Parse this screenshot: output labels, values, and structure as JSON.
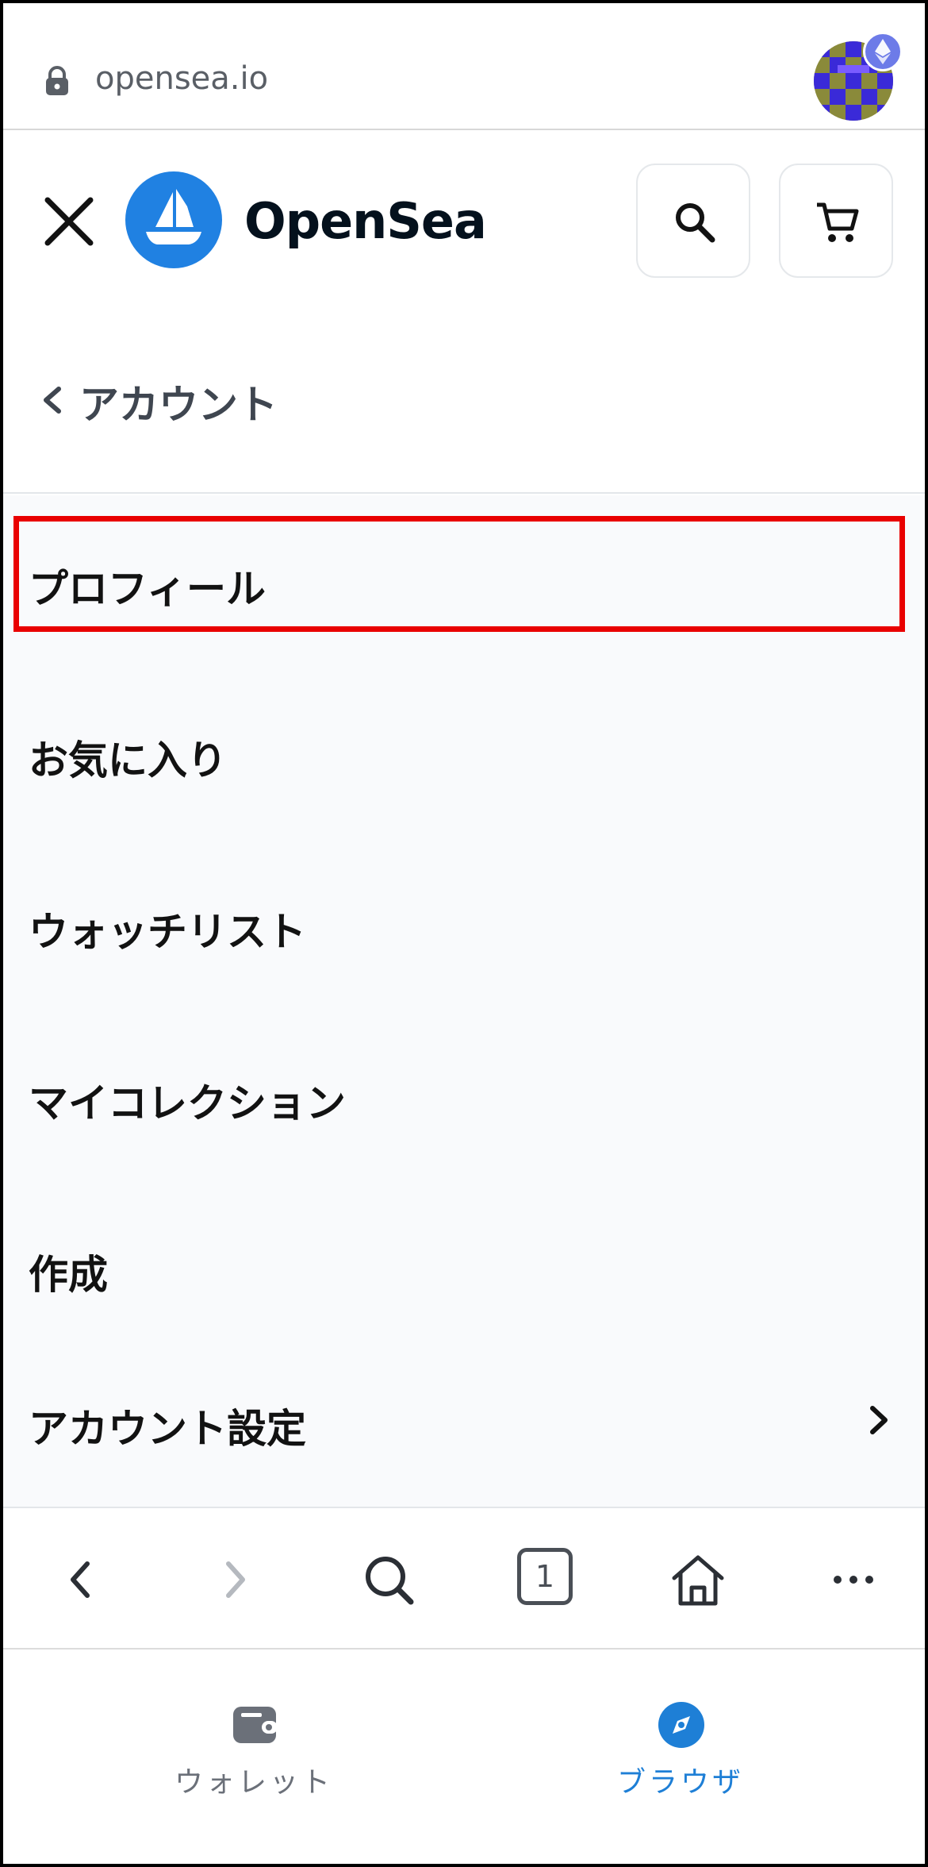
{
  "browser": {
    "url": "opensea.io"
  },
  "header": {
    "brand": "OpenSea",
    "logo_icon": "opensea-ship-logo",
    "buttons": [
      "search-icon",
      "cart-icon"
    ]
  },
  "back": {
    "label": "アカウント"
  },
  "menu": {
    "items": [
      {
        "label": "プロフィール"
      },
      {
        "label": "お気に入り"
      },
      {
        "label": "ウォッチリスト"
      },
      {
        "label": "マイコレクション"
      },
      {
        "label": "作成"
      },
      {
        "label": "アカウント設定"
      }
    ]
  },
  "toolbar": {
    "tab_count": "1",
    "icons": [
      "back-icon",
      "forward-icon",
      "search-icon",
      "tabs-icon",
      "home-icon",
      "more-icon"
    ]
  },
  "bottom_nav": {
    "wallet_label": "ウォレット",
    "browser_label": "ブラウザ"
  },
  "colors": {
    "accent_blue": "#2081e2",
    "highlight_red": "#e90000",
    "browser_active": "#1e7fd6"
  }
}
